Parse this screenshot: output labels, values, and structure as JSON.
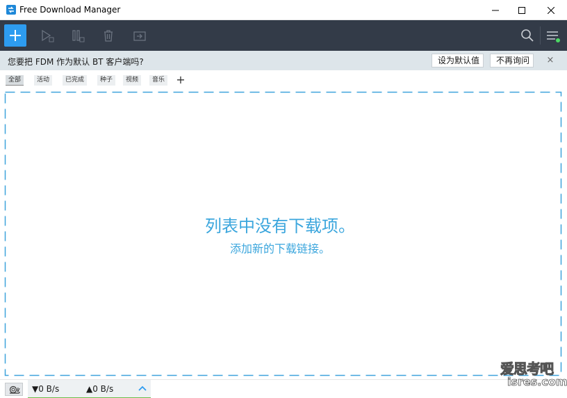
{
  "window": {
    "title": "Free Download Manager",
    "controls": {
      "minimize": "—",
      "maximize": "☐",
      "close": "✕"
    }
  },
  "toolbar": {
    "icons": [
      "add-icon",
      "play-icon",
      "pause-icon",
      "delete-icon",
      "move-icon",
      "search-icon",
      "menu-icon"
    ],
    "colors": {
      "background": "#333b48",
      "add_button": "#2d9cf0",
      "icon_disabled": "#6b7380",
      "icon_active": "#c8ccd2",
      "menu_status_dot": "#4cd964"
    }
  },
  "notice": {
    "text": "您要把 FDM 作为默认 BT 客户端吗?",
    "set_default_label": "设为默认值",
    "never_ask_label": "不再询问",
    "close_label": "×"
  },
  "filters": {
    "tabs": [
      {
        "label": "全部",
        "active": true
      },
      {
        "label": "活动",
        "active": false
      },
      {
        "label": "已完成",
        "active": false
      },
      {
        "label": "种子",
        "active": false
      },
      {
        "label": "视频",
        "active": false
      },
      {
        "label": "音乐",
        "active": false
      }
    ],
    "add_label": "+"
  },
  "main": {
    "empty_title": "列表中没有下载项。",
    "empty_subtitle": "添加新的下载链接。",
    "accent_color": "#3ba6dd"
  },
  "statusbar": {
    "download_speed": "▼0 B/s",
    "upload_speed": "▲0 B/s",
    "icons": [
      "snail-icon",
      "chevron-up-icon"
    ]
  },
  "watermark": {
    "line1": "爱思考吧",
    "line2": "isres.com"
  }
}
